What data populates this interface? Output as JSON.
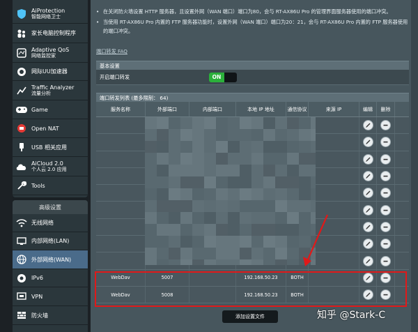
{
  "sidebar": {
    "items": [
      {
        "label": "AiProtection",
        "sub": "智能网络卫士",
        "icon": "shield-icon"
      },
      {
        "label": "家长电脑控制程序",
        "sub": "",
        "icon": "family-icon"
      },
      {
        "label": "Adaptive QoS",
        "sub": "网络监控家",
        "icon": "qos-icon"
      },
      {
        "label": "网际UU加速器",
        "sub": "",
        "icon": "uu-accelerator-icon"
      },
      {
        "label": "Traffic Analyzer",
        "sub": "流量分析",
        "icon": "traffic-icon"
      },
      {
        "label": "Game",
        "sub": "",
        "icon": "gamepad-icon"
      },
      {
        "label": "Open NAT",
        "sub": "",
        "icon": "open-nat-icon"
      },
      {
        "label": "USB 相关应用",
        "sub": "",
        "icon": "usb-icon"
      },
      {
        "label": "AiCloud 2.0",
        "sub": "个人云 2.0 应用",
        "icon": "cloud-icon"
      },
      {
        "label": "Tools",
        "sub": "",
        "icon": "wrench-icon"
      }
    ],
    "advanced_header": "高级设置",
    "advanced_items": [
      {
        "label": "无线网络",
        "icon": "wifi-icon"
      },
      {
        "label": "内部网络(LAN)",
        "icon": "lan-icon"
      },
      {
        "label": "外部网络(WAN)",
        "icon": "globe-icon"
      },
      {
        "label": "IPv6",
        "icon": "ipv6-icon"
      },
      {
        "label": "VPN",
        "icon": "vpn-icon"
      },
      {
        "label": "防火墙",
        "icon": "firewall-icon"
      }
    ]
  },
  "notes": [
    "在关闭防火墙设置 HTTP 服务器，且设置外网（WAN 端口）端口为80，会与 RT-AX86U Pro 的管理界面服务器使用的端口冲突。",
    "当使用 RT-AX86U Pro 内置的 FTP 服务器功能时，设置外网（WAN 端口）端口为20：21，会与 RT-AX86U Pro 内置的 FTP 服务器使用的端口冲突。"
  ],
  "faq_link": "端口转发 FAQ",
  "basic": {
    "header": "基本设置",
    "enable_label": "开启端口转发",
    "toggle": "ON"
  },
  "list": {
    "header": "端口转发列表 (最多限制： 64)",
    "columns": [
      "服务名称",
      "外部端口",
      "内部端口",
      "本地 IP 地址",
      "通信协议",
      "来源 IP",
      "编辑",
      "删除"
    ],
    "rows": [
      {
        "name": "WebDav",
        "ext": "5007",
        "int": "",
        "ip": "192.168.50.23",
        "proto": "BOTH",
        "src": ""
      },
      {
        "name": "WebDav",
        "ext": "5008",
        "int": "",
        "ip": "192.168.50.23",
        "proto": "BOTH",
        "src": ""
      }
    ]
  },
  "add_button": "添加设置文件",
  "watermark": "知乎 @Stark-C",
  "colors": {
    "accent_on": "#2bb03b",
    "highlight": "#e01919"
  }
}
